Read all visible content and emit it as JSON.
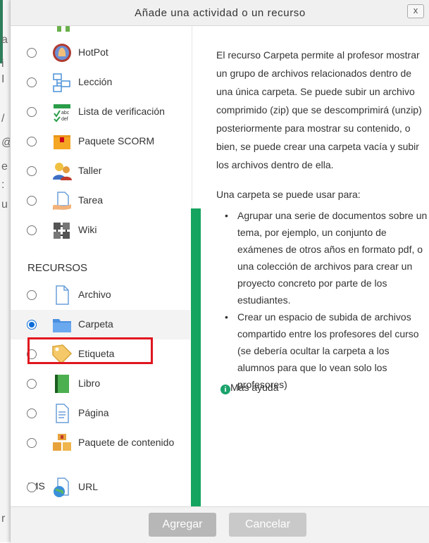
{
  "dialog": {
    "title": "Añade una actividad o un recurso",
    "close_symbol": "x"
  },
  "activities": [
    {
      "label": "HotPot",
      "icon": "hotpot-icon",
      "selected": false
    },
    {
      "label": "Lección",
      "icon": "lesson-icon",
      "selected": false
    },
    {
      "label": "Lista de verificación",
      "icon": "checklist-icon",
      "selected": false
    },
    {
      "label": "Paquete SCORM",
      "icon": "scorm-icon",
      "selected": false
    },
    {
      "label": "Taller",
      "icon": "workshop-icon",
      "selected": false
    },
    {
      "label": "Tarea",
      "icon": "assignment-icon",
      "selected": false
    },
    {
      "label": "Wiki",
      "icon": "wiki-icon",
      "selected": false
    }
  ],
  "resources_heading": "RECURSOS",
  "resources": [
    {
      "label": "Archivo",
      "icon": "file-icon",
      "selected": false
    },
    {
      "label": "Carpeta",
      "icon": "folder-icon",
      "selected": true
    },
    {
      "label": "Etiqueta",
      "icon": "label-icon",
      "selected": false
    },
    {
      "label": "Libro",
      "icon": "book-icon",
      "selected": false
    },
    {
      "label": "Página",
      "icon": "page-icon",
      "selected": false
    },
    {
      "label": "Paquete de contenido",
      "label_wrap": "IMS",
      "icon": "ims-package-icon",
      "selected": false
    },
    {
      "label": "URL",
      "icon": "url-icon",
      "selected": false
    }
  ],
  "description": {
    "intro": "El recurso Carpeta permite al profesor mostrar un grupo de archivos relacionados dentro de una única carpeta. Se puede subir un archivo comprimido (zip) que se descomprimirá (unzip) posteriormente para mostrar su contenido, o bien, se puede crear una carpeta vacía y subir los archivos dentro de ella.",
    "uses_title": "Una carpeta se puede usar para:",
    "bullets": [
      "Agrupar una serie de documentos sobre un tema, por ejemplo, un conjunto de exámenes de otros años en formato pdf, o una colección de archivos para crear un proyecto concreto por parte de los estudiantes.",
      "Crear un espacio de subida de archivos compartido entre los profesores del curso (se debería ocultar la carpeta a los alumnos para que lo vean solo los profesores)"
    ],
    "more_help": "Más ayuda",
    "info_symbol": "i"
  },
  "footer": {
    "add_label": "Agregar",
    "cancel_label": "Cancelar"
  },
  "background_fragments": [
    "a",
    "i",
    "I",
    "/",
    "@",
    "e",
    ":",
    "u",
    "r"
  ],
  "colors": {
    "accent_green": "#15a45f",
    "selection_border": "#e0161f",
    "radio_checked": "#0b6cd8",
    "button_disabled": "#b7b7b7"
  }
}
